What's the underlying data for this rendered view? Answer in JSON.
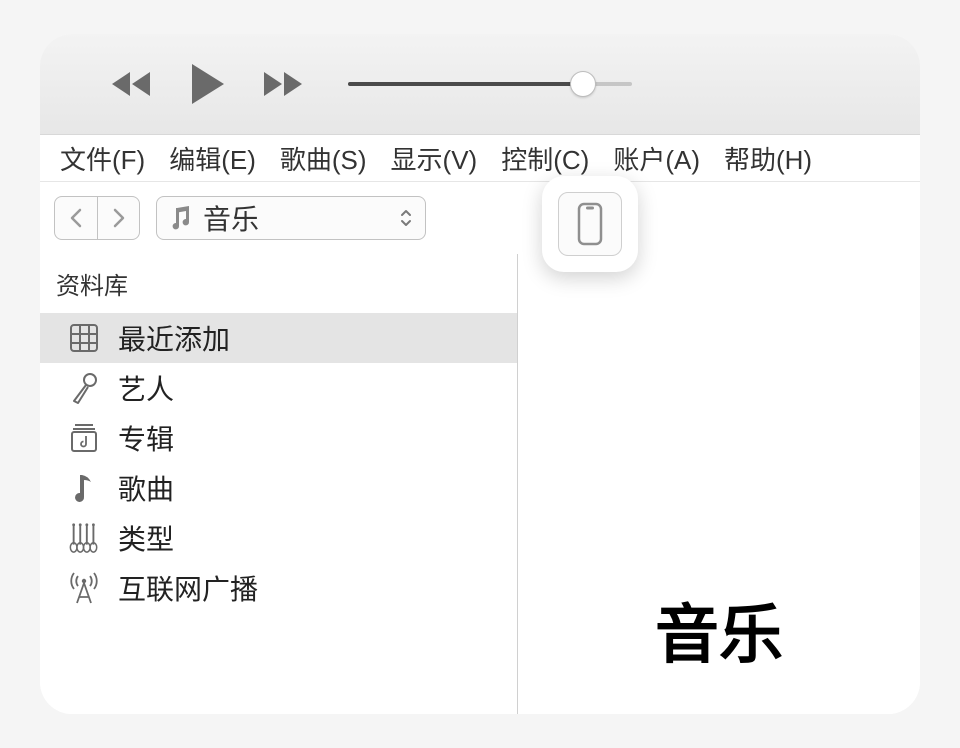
{
  "menu": {
    "items": [
      "文件(F)",
      "编辑(E)",
      "歌曲(S)",
      "显示(V)",
      "控制(C)",
      "账户(A)",
      "帮助(H)"
    ]
  },
  "toolbar": {
    "media_picker_label": "音乐"
  },
  "sidebar": {
    "section_header": "资料库",
    "items": [
      {
        "label": "最近添加",
        "icon": "grid-icon",
        "selected": true
      },
      {
        "label": "艺人",
        "icon": "microphone-icon",
        "selected": false
      },
      {
        "label": "专辑",
        "icon": "album-icon",
        "selected": false
      },
      {
        "label": "歌曲",
        "icon": "note-icon",
        "selected": false
      },
      {
        "label": "类型",
        "icon": "guitar-icon",
        "selected": false
      },
      {
        "label": "互联网广播",
        "icon": "radio-tower-icon",
        "selected": false
      }
    ]
  },
  "main": {
    "title": "音乐"
  },
  "colors": {
    "icon_gray": "#6a6a6a",
    "selection_bg": "#e4e4e4"
  }
}
